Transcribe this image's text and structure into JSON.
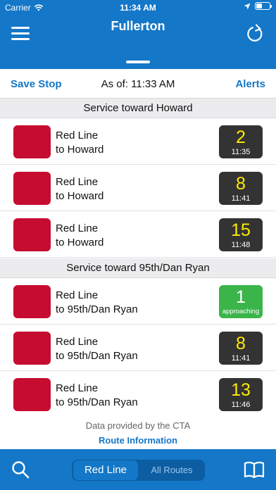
{
  "status_bar": {
    "carrier": "Carrier",
    "time": "11:34 AM"
  },
  "header": {
    "title": "Fullerton",
    "menu_icon": "hamburger-menu-icon",
    "refresh_icon": "refresh-icon"
  },
  "toolbar": {
    "save_label": "Save Stop",
    "as_of": "As of: 11:33 AM",
    "alerts_label": "Alerts"
  },
  "colors": {
    "brand_blue": "#1477c8",
    "red_line": "#c60c30",
    "badge_dark": "#333333",
    "badge_approaching": "#3bb54a",
    "minutes_yellow": "#ffea00"
  },
  "sections": [
    {
      "title": "Service toward Howard",
      "arrivals": [
        {
          "route": "Red Line",
          "destination": "to Howard",
          "minutes": "2",
          "time": "11:35"
        },
        {
          "route": "Red Line",
          "destination": "to Howard",
          "minutes": "8",
          "time": "11:41"
        },
        {
          "route": "Red Line",
          "destination": "to Howard",
          "minutes": "15",
          "time": "11:48"
        }
      ]
    },
    {
      "title": "Service toward 95th/Dan Ryan",
      "arrivals": [
        {
          "route": "Red Line",
          "destination": "to 95th/Dan Ryan",
          "minutes": "1",
          "time": "approaching"
        },
        {
          "route": "Red Line",
          "destination": "to 95th/Dan Ryan",
          "minutes": "8",
          "time": "11:41"
        },
        {
          "route": "Red Line",
          "destination": "to 95th/Dan Ryan",
          "minutes": "13",
          "time": "11:46"
        }
      ]
    }
  ],
  "footer": {
    "provided_by": "Data provided by the CTA",
    "route_info": "Route Information"
  },
  "bottom_bar": {
    "segments": [
      "Red Line",
      "All Routes"
    ],
    "selected": "Red Line",
    "search_icon": "search-icon",
    "book_icon": "book-icon"
  }
}
